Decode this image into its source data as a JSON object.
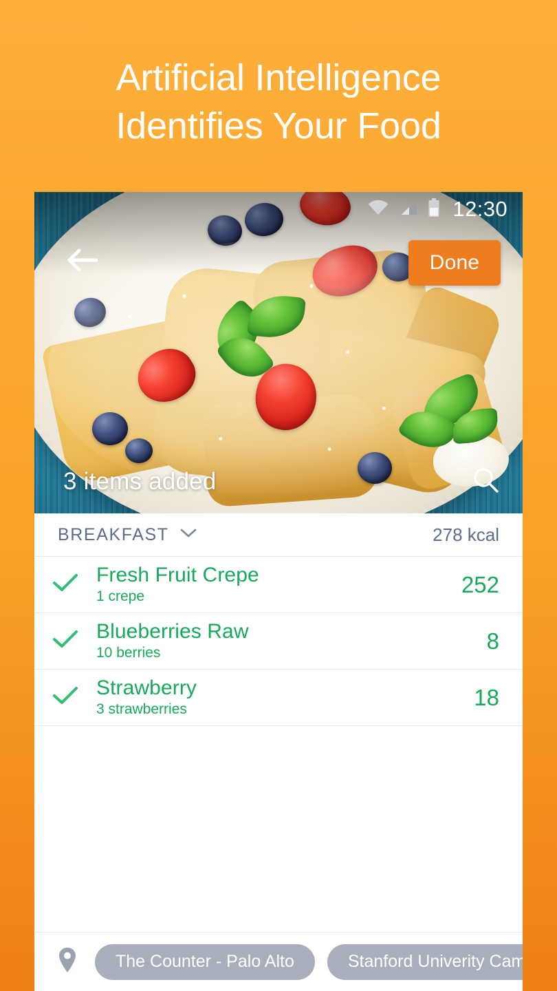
{
  "promo": {
    "headline": "Artificial Intelligence\nIdentifies Your Food",
    "background_top_color": "#FCB03B",
    "background_bottom_color": "#EE8016"
  },
  "statusbar": {
    "time": "12:30",
    "wifi_icon": "wifi-icon",
    "signal_icon": "cellular-signal-icon",
    "battery_icon": "battery-icon"
  },
  "hero": {
    "back_icon": "back-arrow-icon",
    "done_label": "Done",
    "done_color": "#ED7D1E",
    "items_added": "3 items added",
    "search_icon": "search-icon",
    "photo_alt": "plate of crepes with powdered sugar, strawberries, blueberries and mint"
  },
  "meal": {
    "name": "BREAKFAST",
    "chevron_icon": "chevron-down-icon",
    "total_kcal": "278 kcal",
    "label_color": "#5E6C8B"
  },
  "items": [
    {
      "checked": true,
      "name": "Fresh Fruit Crepe",
      "quantity": "1 crepe",
      "calories": "252"
    },
    {
      "checked": true,
      "name": "Blueberries Raw",
      "quantity": "10 berries",
      "calories": "8"
    },
    {
      "checked": true,
      "name": "Strawberry",
      "quantity": "3 strawberries",
      "calories": "18"
    }
  ],
  "item_accent_color": "#17A95A",
  "location": {
    "pin_icon": "location-pin-icon",
    "chips": [
      {
        "label": "The Counter - Palo Alto"
      },
      {
        "label": "Stanford Univerity Camp"
      }
    ],
    "chip_color": "#A8AEBC"
  }
}
